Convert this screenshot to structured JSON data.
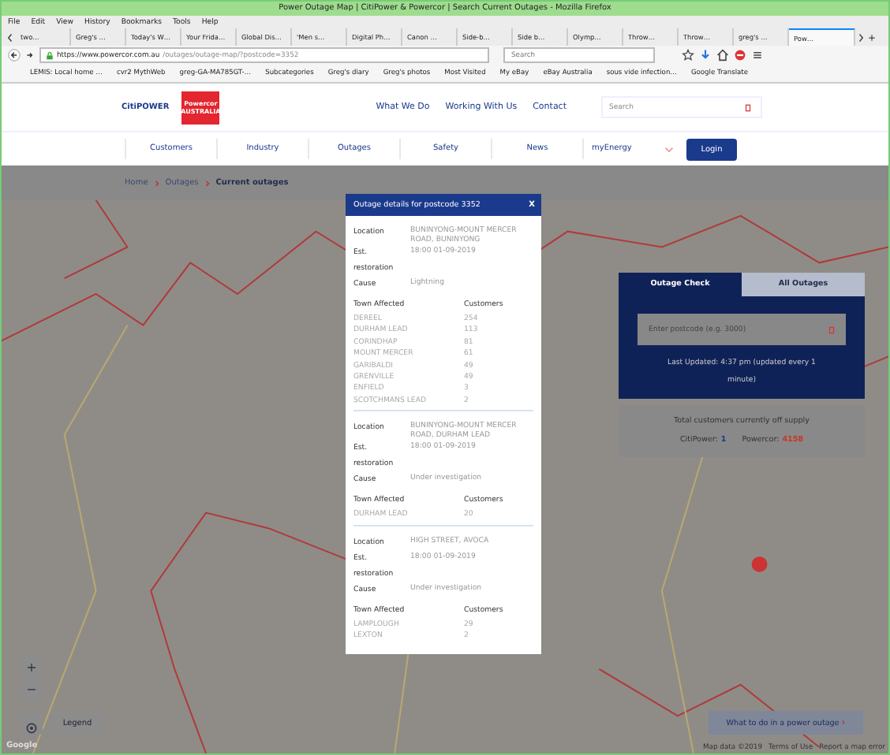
{
  "browser": {
    "title": "Power Outage Map | CitiPower & Powercor | Search Current Outages - Mozilla Firefox",
    "menu": [
      "File",
      "Edit",
      "View",
      "History",
      "Bookmarks",
      "Tools",
      "Help"
    ],
    "tabs": [
      {
        "label": "two…",
        "selected": false
      },
      {
        "label": "Greg's …",
        "selected": false
      },
      {
        "label": "Today's W…",
        "selected": false
      },
      {
        "label": "Your Frida…",
        "selected": false
      },
      {
        "label": "Global Dis…",
        "selected": false
      },
      {
        "label": "'Men s…",
        "selected": false
      },
      {
        "label": "Digital Ph…",
        "selected": false
      },
      {
        "label": "Canon …",
        "selected": false
      },
      {
        "label": "Side-b…",
        "selected": false
      },
      {
        "label": "Side b…",
        "selected": false
      },
      {
        "label": "Olymp…",
        "selected": false
      },
      {
        "label": "Throw…",
        "selected": false
      },
      {
        "label": "Throw…",
        "selected": false
      },
      {
        "label": "greg's …",
        "selected": false
      },
      {
        "label": "Pow…",
        "selected": true
      }
    ],
    "url_host": "https://www.powercor.com.au",
    "url_path": "/outages/outage-map/?postcode=3352",
    "search_placeholder": "Search",
    "bookmarks": [
      "LEMIS: Local home …",
      "cvr2 MythWeb",
      "greg-GA-MA785GT-…",
      "Subcategories",
      "Greg's diary",
      "Greg's photos",
      "Most Visited",
      "My eBay",
      "eBay Australia",
      "sous vide infection…",
      "Google Translate"
    ]
  },
  "site": {
    "logo_citipower": "CitiPOWER",
    "logo_powercor": "Powercor",
    "logo_powercor_sub": "AUSTRALIA",
    "top_links": [
      "What We Do",
      "Working With Us",
      "Contact"
    ],
    "search_placeholder": "Search",
    "nav": [
      "Customers",
      "Industry",
      "Outages",
      "Safety",
      "News",
      "myEnergy"
    ],
    "login": "Login"
  },
  "breadcrumb": [
    {
      "label": "Home",
      "selected": false
    },
    {
      "label": "Outages",
      "selected": false
    },
    {
      "label": "Current outages",
      "selected": true
    }
  ],
  "modal": {
    "title": "Outage details for postcode 3352",
    "close": "X",
    "outages": [
      {
        "location_label": "Location",
        "location": "BUNINYONG-MOUNT MERCER ROAD, BUNINYONG",
        "restoration_label": "Est. restoration",
        "restoration": "18:00 01-09-2019",
        "cause_label": "Cause",
        "cause": "Lightning",
        "town_label": "Town Affected",
        "customers_label": "Customers",
        "towns": [
          {
            "town": "DEREEL",
            "customers": "254"
          },
          {
            "town": "DURHAM LEAD",
            "customers": "113"
          },
          {
            "town": "CORINDHAP",
            "customers": "81"
          },
          {
            "town": "MOUNT MERCER",
            "customers": "61"
          },
          {
            "town": "GARIBALDI",
            "customers": "49"
          },
          {
            "town": "GRENVILLE",
            "customers": "49"
          },
          {
            "town": "ENFIELD",
            "customers": "3"
          },
          {
            "town": "SCOTCHMANS LEAD",
            "customers": "2"
          }
        ]
      },
      {
        "location_label": "Location",
        "location": "BUNINYONG-MOUNT MERCER ROAD, DURHAM LEAD",
        "restoration_label": "Est. restoration",
        "restoration": "18:00 01-09-2019",
        "cause_label": "Cause",
        "cause": "Under investigation",
        "town_label": "Town Affected",
        "customers_label": "Customers",
        "towns": [
          {
            "town": "DURHAM LEAD",
            "customers": "20"
          }
        ]
      },
      {
        "location_label": "Location",
        "location": "HIGH STREET, AVOCA",
        "restoration_label": "Est. restoration",
        "restoration": "18:00 01-09-2019",
        "cause_label": "Cause",
        "cause": "Under investigation",
        "town_label": "Town Affected",
        "customers_label": "Customers",
        "towns": [
          {
            "town": "LAMPLOUGH",
            "customers": "29"
          },
          {
            "town": "LEXTON",
            "customers": "2"
          }
        ]
      }
    ]
  },
  "outage_panel": {
    "tabs": [
      {
        "label": "Outage Check",
        "selected": true
      },
      {
        "label": "All Outages",
        "selected": false
      }
    ],
    "postcode_placeholder": "Enter postcode (e.g. 3000)",
    "last_updated": "Last Updated: 4:37 pm (updated every 1 minute)",
    "totals_title": "Total customers currently off supply",
    "citipower_label": "CitiPower:",
    "citipower_value": "1",
    "powercor_label": "Powercor:",
    "powercor_value": "4158"
  },
  "map": {
    "zoom_in": "+",
    "zoom_out": "−",
    "legend": "Legend",
    "help": "What to do in a power outage",
    "help_arrow": "›",
    "google": "Google",
    "attribution": [
      "Map data ©2019",
      "Terms of Use",
      "Report a map error"
    ]
  }
}
